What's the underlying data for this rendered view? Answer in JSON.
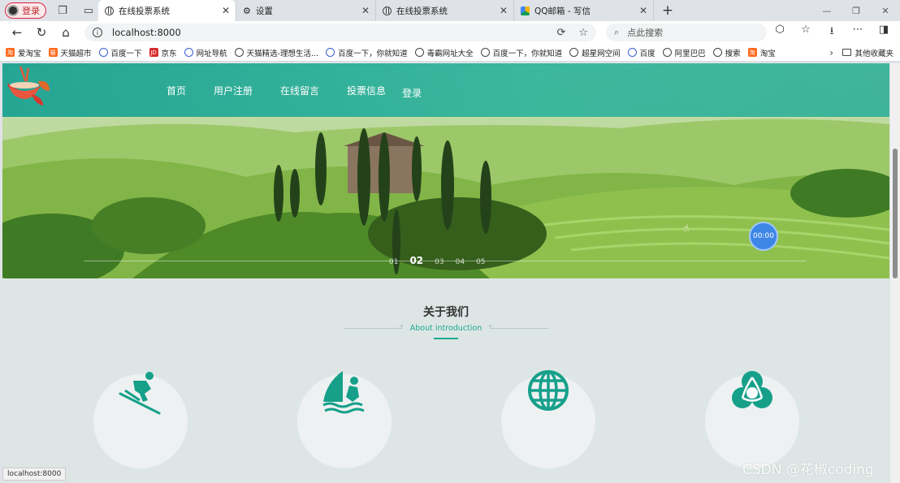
{
  "browser": {
    "profile_label": "登录",
    "tabs": [
      {
        "title": "在线投票系统",
        "active": true
      },
      {
        "title": "设置",
        "active": false
      },
      {
        "title": "在线投票系统",
        "active": false
      },
      {
        "title": "QQ邮箱 - 写信",
        "active": false
      }
    ],
    "address": "localhost:8000",
    "search_placeholder": "点此搜索",
    "bookmarks": [
      "爱淘宝",
      "天猫超市",
      "百度一下",
      "京东",
      "网址导航",
      "天猫精选-理想生活...",
      "百度一下，你就知道",
      "毒霸网址大全",
      "百度一下，你就知道",
      "超星网空间",
      "百度",
      "阿里巴巴",
      "搜索",
      "淘宝"
    ],
    "other_bookmarks": "其他收藏夹",
    "status_url": "localhost:8000"
  },
  "site": {
    "nav": [
      "首页",
      "用户注册",
      "在线留言",
      "投票信息"
    ],
    "login": "登录",
    "slider": {
      "dots": [
        "01",
        "02",
        "03",
        "04",
        "05"
      ],
      "active_index": 1,
      "timer": "00:00"
    },
    "about": {
      "title": "关于我们",
      "subtitle": "About introduction"
    },
    "features": [
      {
        "icon": "skiing-icon"
      },
      {
        "icon": "windsurfing-icon"
      },
      {
        "icon": "globe-icon"
      },
      {
        "icon": "trinity-knot-icon"
      }
    ],
    "accent_color": "#1aa98f"
  },
  "watermark": "CSDN @花椒coding"
}
